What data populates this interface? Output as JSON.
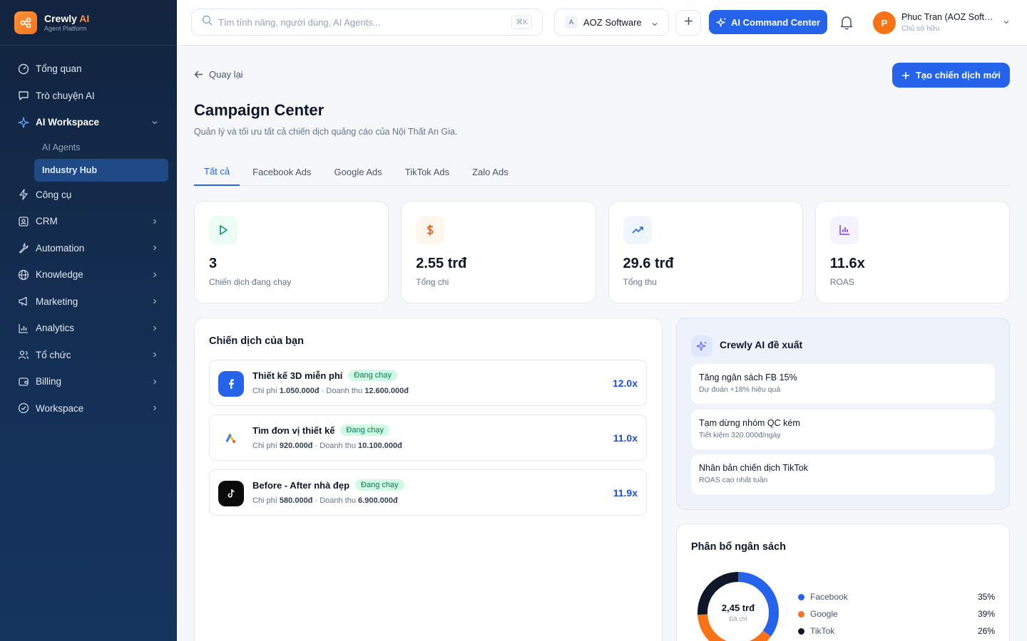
{
  "brand": {
    "name": "Crewly",
    "name_ai": "AI",
    "sub": "Agent Platform"
  },
  "sidebar": {
    "items": [
      {
        "label": "Tổng quan"
      },
      {
        "label": "Trò chuyện AI"
      },
      {
        "label": "AI Workspace"
      },
      {
        "label": "Công cụ"
      },
      {
        "label": "CRM"
      },
      {
        "label": "Automation"
      },
      {
        "label": "Knowledge"
      },
      {
        "label": "Marketing"
      },
      {
        "label": "Analytics"
      },
      {
        "label": "Tổ chức"
      },
      {
        "label": "Billing"
      },
      {
        "label": "Workspace"
      }
    ],
    "sub_items": [
      {
        "label": "AI Agents"
      },
      {
        "label": "Industry Hub"
      }
    ]
  },
  "topbar": {
    "search_placeholder": "Tìm tính năng, người dùng, AI Agents...",
    "shortcut": "⌘K",
    "org_initial": "A",
    "org_name": "AOZ Software",
    "command_label": "AI Command Center",
    "user_initial": "P",
    "user_name": "Phuc Tran (AOZ Software)",
    "user_role": "Chủ sở hữu"
  },
  "page": {
    "back_label": "Quay lại",
    "new_button": "Tạo chiến dịch mới",
    "title": "Campaign Center",
    "subtitle": "Quản lý và tối ưu tất cả chiến dịch quảng cáo của Nội Thất An Gia.",
    "tabs": [
      {
        "label": "Tất cả"
      },
      {
        "label": "Facebook Ads"
      },
      {
        "label": "Google Ads"
      },
      {
        "label": "TikTok Ads"
      },
      {
        "label": "Zalo Ads"
      }
    ]
  },
  "stats": [
    {
      "value": "3",
      "label": "Chiến dịch đang chạy",
      "icon": "play-icon",
      "color": "#10b981"
    },
    {
      "value": "2.55 trđ",
      "label": "Tổng chi",
      "icon": "dollar-icon",
      "color": "#f97316"
    },
    {
      "value": "29.6 trđ",
      "label": "Tổng thu",
      "icon": "trend-up-icon",
      "color": "#3b82f6"
    },
    {
      "value": "11.6x",
      "label": "ROAS",
      "icon": "bar-chart-icon",
      "color": "#8b5cf6"
    }
  ],
  "campaigns": {
    "title": "Chiến dịch của bạn",
    "items": [
      {
        "name": "Thiết kế 3D miễn phí",
        "status": "Đang chạy",
        "cost_label": "Chi phí",
        "cost": "1.050.000đ",
        "sep": "·",
        "revenue_label": "Doanh thu",
        "revenue": "12.600.000đ",
        "roas": "12.0x",
        "platform_icon": "facebook-icon"
      },
      {
        "name": "Tìm đơn vị thiết kế",
        "status": "Đang chạy",
        "cost_label": "Chi phí",
        "cost": "920.000đ",
        "sep": "·",
        "revenue_label": "Doanh thu",
        "revenue": "10.100.000đ",
        "roas": "11.0x",
        "platform_icon": "google-ads-icon"
      },
      {
        "name": "Before - After nhà đẹp",
        "status": "Đang chạy",
        "cost_label": "Chi phí",
        "cost": "580.000đ",
        "sep": "·",
        "revenue_label": "Doanh thu",
        "revenue": "6.900.000đ",
        "roas": "11.9x",
        "platform_icon": "tiktok-icon"
      }
    ]
  },
  "ai_suggest": {
    "title": "Crewly AI đề xuất",
    "items": [
      {
        "title": "Tăng ngân sách FB 15%",
        "sub": "Dự đoán +18% hiệu quả"
      },
      {
        "title": "Tạm dừng nhóm QC kém",
        "sub": "Tiết kiệm 320.000đ/ngày"
      },
      {
        "title": "Nhân bản chiến dịch TikTok",
        "sub": "ROAS cao nhất tuần"
      }
    ]
  },
  "budget": {
    "title": "Phân bổ ngân sách",
    "total": "2,45 trđ",
    "total_sub": "Đã chi",
    "legend": [
      {
        "name": "Facebook",
        "pct_label": "35%",
        "pct": 35,
        "color": "#2563eb"
      },
      {
        "name": "Google",
        "pct_label": "39%",
        "pct": 39,
        "color": "#f97316"
      },
      {
        "name": "TikTok",
        "pct_label": "26%",
        "pct": 26,
        "color": "#0f172a"
      }
    ]
  }
}
